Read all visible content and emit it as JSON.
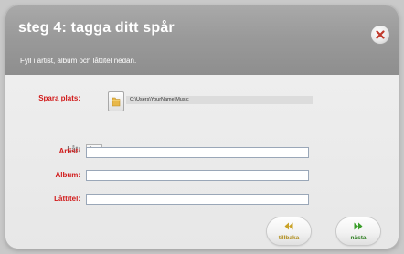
{
  "dialog": {
    "title": "steg 4: tagga ditt spår",
    "subtitle": "Fyll i artist, album och låttitel nedan."
  },
  "form": {
    "save_location_label": "Spara plats:",
    "save_location_path": "C:\\Users\\YourName\\Music",
    "track_label": "Låt:",
    "track_number": "1",
    "artist_label": "Artist:",
    "artist_value": "",
    "album_label": "Album:",
    "album_value": "",
    "title_label": "Låttitel:",
    "title_value": ""
  },
  "buttons": {
    "back_label": "tillbaka",
    "next_label": "nästa"
  },
  "colors": {
    "header": "#9a9a9a",
    "label_red": "#d11a1a",
    "back_arrow": "#c9a227",
    "next_arrow": "#3a9e2a",
    "close_x": "#c0392b"
  },
  "icons": {
    "close": "close-icon",
    "folder": "folder-icon",
    "back": "double-chevron-left-icon",
    "next": "double-chevron-right-icon"
  }
}
